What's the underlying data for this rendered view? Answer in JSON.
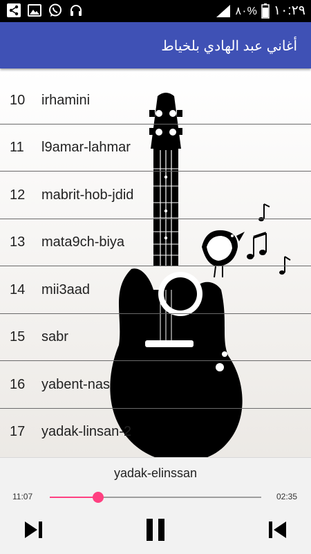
{
  "status_bar": {
    "battery": "٨٠%",
    "time": "١٠:٢٩",
    "left_icons": [
      "share-icon",
      "image-icon",
      "whatsapp-icon",
      "headphones-icon"
    ]
  },
  "app_bar": {
    "title": "أغاني عبد الهادي بلخياط",
    "color": "#3f51b5"
  },
  "songs": [
    {
      "num": "10",
      "title": "irhamini"
    },
    {
      "num": "11",
      "title": "l9amar-lahmar"
    },
    {
      "num": "12",
      "title": "mabrit-hob-jdid"
    },
    {
      "num": "13",
      "title": "mata9ch-biya"
    },
    {
      "num": "14",
      "title": "mii3aad"
    },
    {
      "num": "15",
      "title": "sabr"
    },
    {
      "num": "16",
      "title": "yabent-nas"
    },
    {
      "num": "17",
      "title": "yadak-linsan-2"
    }
  ],
  "player": {
    "now_playing": "yadak-elinssan",
    "current_time": "11:07",
    "total_time": "02:35",
    "progress": 0.23,
    "accent": "#ff4081",
    "buttons": [
      "next-icon",
      "pause-icon",
      "previous-icon"
    ]
  }
}
